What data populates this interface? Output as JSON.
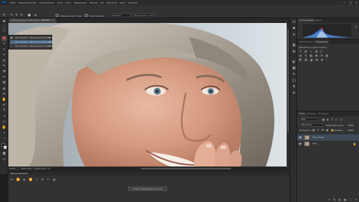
{
  "app": {
    "logo": "Ps",
    "window_controls": [
      "—",
      "□",
      "✕"
    ]
  },
  "menu": [
    "Файл",
    "Редактирование",
    "Изображение",
    "Слои",
    "Текст",
    "Выделение",
    "Фильтр",
    "3D",
    "Просмотр",
    "Окно",
    "Справка"
  ],
  "options_bar": {
    "sample_all_layers": "Образец всех слоев",
    "enhance_edge": "Усилить край",
    "select_subject": "Предмет",
    "select_and_mask": "Выделение и маска..."
  },
  "document": {
    "tab_title": "вопросы.jpg @ 16,6% (Фон, RGB/8#) *",
    "zoom": "16,6%",
    "dims": "3809 пикс. x 3303 пикс. (72 ppi)"
  },
  "tool_flyout": {
    "items": [
      {
        "icon": "▩",
        "label": "Инструмент «Выделение объектов»",
        "key": "W"
      },
      {
        "icon": "◌",
        "label": "Инструмент «Быстрое выделение»",
        "key": "W"
      },
      {
        "icon": "✧",
        "label": "Инструмент «Волшебная палочка»",
        "key": "W"
      }
    ]
  },
  "timeline": {
    "title": "Шкала времени",
    "create_button": "Создать временную шкалу",
    "controls": [
      "⏮",
      "⏪",
      "▶",
      "⏩",
      "♪",
      "⚙",
      "✂",
      "▦"
    ]
  },
  "panels": {
    "histogram_tabs": [
      "Гистограмма",
      "Инфо"
    ],
    "properties_tabs": [
      "Библиотеки",
      "Коррекция"
    ],
    "adjust_title": "Добавить корректировку",
    "layers_tabs": [
      "Слои",
      "Каналы",
      "Контуры"
    ],
    "layer_filter": "Вид",
    "blend_mode": "Обычные",
    "opacity_label": "Непрозрачность:",
    "opacity": "100%",
    "lock_label": "Закрепить:",
    "fill_label": "Заливка:",
    "fill": "100%",
    "layers": [
      {
        "name": "Фон копия",
        "visible": true
      },
      {
        "name": "Фон",
        "visible": true
      }
    ],
    "layer_buttons": [
      "⚭",
      "fx",
      "◐",
      "▣",
      "⬚",
      "✕"
    ]
  },
  "toolbar_icons": [
    "✥",
    "⬚",
    "⌒",
    "▩",
    "⌑",
    "⌕",
    "✁",
    "◎",
    "✎",
    "⚒",
    "✏",
    "⌘",
    "◭",
    "☠",
    "✋",
    "✐",
    "T",
    "↗",
    "▭",
    "✋",
    "⌕",
    "⋯"
  ],
  "colors": {
    "accent": "#31a8ff",
    "histogram": [
      "#ff3b3b",
      "#3bff5a",
      "#3b6bff",
      "#ffe14d",
      "#ff40ff",
      "#40ffff"
    ]
  }
}
